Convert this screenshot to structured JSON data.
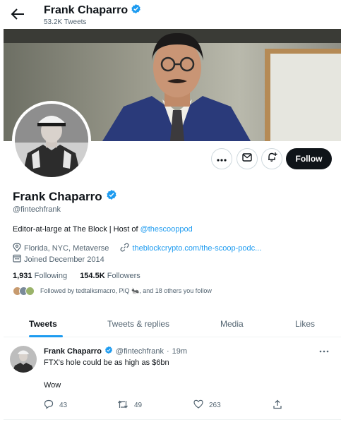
{
  "header": {
    "name": "Frank Chaparro",
    "tweet_count": "53.2K Tweets"
  },
  "profile": {
    "name": "Frank Chaparro",
    "handle": "@fintechfrank",
    "bio_prefix": "Editor-at-large at The Block | Host of ",
    "bio_link": "@thescooppod",
    "location": "Florida, NYC, Metaverse",
    "website": "theblockcrypto.com/the-scoop-podc...",
    "joined": "Joined December 2014",
    "following_count": "1,931",
    "following_label": "Following",
    "followers_count": "154.5K",
    "followers_label": "Followers",
    "followed_by": "Followed by tedtalksmacro, PiQ 🐜, and 18 others you follow"
  },
  "actions": {
    "follow_label": "Follow"
  },
  "tabs": [
    {
      "label": "Tweets",
      "active": true
    },
    {
      "label": "Tweets & replies",
      "active": false
    },
    {
      "label": "Media",
      "active": false
    },
    {
      "label": "Likes",
      "active": false
    }
  ],
  "tweet": {
    "author_name": "Frank Chaparro",
    "author_handle": "@fintechfrank",
    "separator": "·",
    "time": "19m",
    "line1": "FTX's hole could be as high as $6bn",
    "line2": "Wow",
    "replies": "43",
    "retweets": "49",
    "likes": "263"
  },
  "colors": {
    "accent": "#1d9bf0",
    "text": "#0f1419",
    "muted": "#536471",
    "verified": "#1d9bf0"
  },
  "icons": [
    "back-arrow-icon",
    "verified-badge-icon",
    "more-icon",
    "message-icon",
    "notifications-icon",
    "location-icon",
    "link-icon",
    "calendar-icon",
    "reply-icon",
    "retweet-icon",
    "like-icon",
    "share-icon"
  ]
}
